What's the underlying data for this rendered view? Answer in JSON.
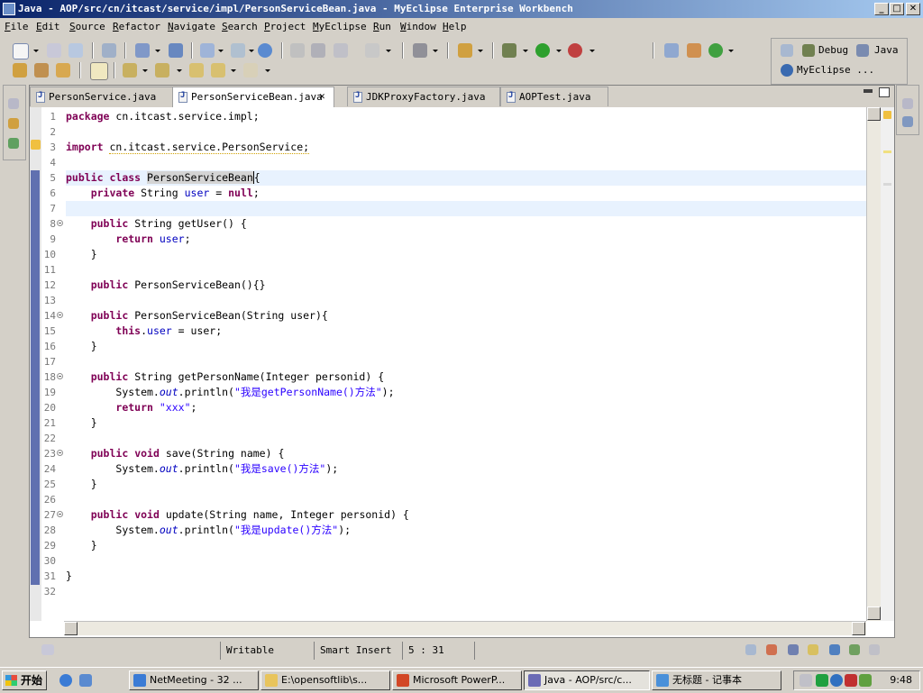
{
  "window": {
    "title": "Java - AOP/src/cn/itcast/service/impl/PersonServiceBean.java - MyEclipse Enterprise Workbench"
  },
  "menu": [
    "File",
    "Edit",
    "Source",
    "Refactor",
    "Navigate",
    "Search",
    "Project",
    "MyEclipse",
    "Run",
    "Window",
    "Help"
  ],
  "perspectives": {
    "debug": "Debug",
    "java": "Java",
    "myeclipse": "MyEclipse ..."
  },
  "tabs": [
    {
      "label": "PersonService.java",
      "active": false
    },
    {
      "label": "PersonServiceBean.java",
      "active": true
    },
    {
      "label": "JDKProxyFactory.java",
      "active": false
    },
    {
      "label": "AOPTest.java",
      "active": false
    }
  ],
  "code": {
    "line_numbers": [
      "1",
      "2",
      "3",
      "4",
      "5",
      "6",
      "7",
      "8",
      "9",
      "10",
      "11",
      "12",
      "13",
      "14",
      "15",
      "16",
      "17",
      "18",
      "19",
      "20",
      "21",
      "22",
      "23",
      "24",
      "25",
      "26",
      "27",
      "28",
      "29",
      "30",
      "31",
      "32"
    ]
  },
  "status": {
    "writable": "Writable",
    "insert_mode": "Smart Insert",
    "position": "5 : 31"
  },
  "taskbar": {
    "start": "开始",
    "items": [
      {
        "label": "NetMeeting - 32 ...",
        "icon_color": "#3a7bd5"
      },
      {
        "label": "E:\\opensoftlib\\s...",
        "icon_color": "#e8c45c"
      },
      {
        "label": "Microsoft PowerP...",
        "icon_color": "#d24726"
      },
      {
        "label": "Java - AOP/src/c...",
        "icon_color": "#6b6bb5"
      },
      {
        "label": "无标题 - 记事本",
        "icon_color": "#4a90d9"
      }
    ],
    "clock": "9:48"
  }
}
